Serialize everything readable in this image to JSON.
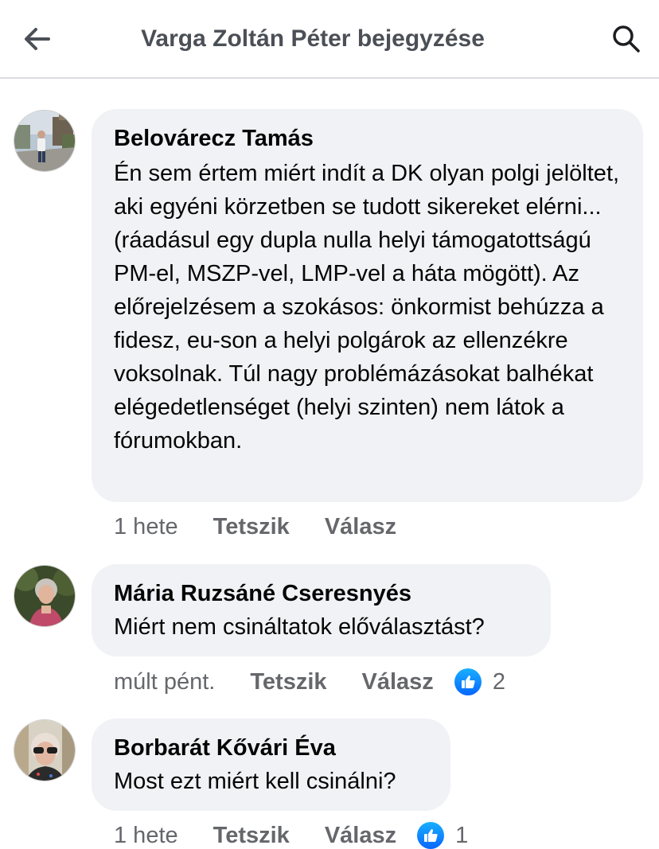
{
  "header": {
    "title": "Varga Zoltán Péter bejegyzése",
    "back_icon": "arrow-left-icon",
    "search_icon": "search-icon"
  },
  "comments": [
    {
      "author": "Belovárecz Tamás",
      "text": "Én sem értem miért indít a DK olyan polgi jelöltet, aki egyéni körzetben se tudott sikereket elérni...(ráadásul egy dupla nulla helyi támogatottságú PM-el, MSZP-vel, LMP-vel a háta mögött). Az előrejelzésem a szokásos: önkormist behúzza a fidesz, eu-son a helyi polgárok az ellenzékre voksolnak. Túl nagy problémázásokat balhékat elégedetlenséget (helyi szinten) nem látok a fórumokban.",
      "time": "1 hete",
      "like_label": "Tetszik",
      "reply_label": "Válasz"
    },
    {
      "author": "Mária Ruzsáné Cseresnyés",
      "text": "Miért nem csináltatok előválasztást?",
      "time": "múlt pént.",
      "like_label": "Tetszik",
      "reply_label": "Válasz",
      "reaction_count": "2"
    },
    {
      "author": "Borbarát Kővári Éva",
      "text": "Most ezt miért kell csinálni?",
      "time": "1 hete",
      "like_label": "Tetszik",
      "reply_label": "Válasz",
      "reaction_count": "1"
    }
  ],
  "colors": {
    "bubble": "#f0f2f5",
    "secondary_text": "#65676b",
    "like_blue": "#0866ff"
  }
}
